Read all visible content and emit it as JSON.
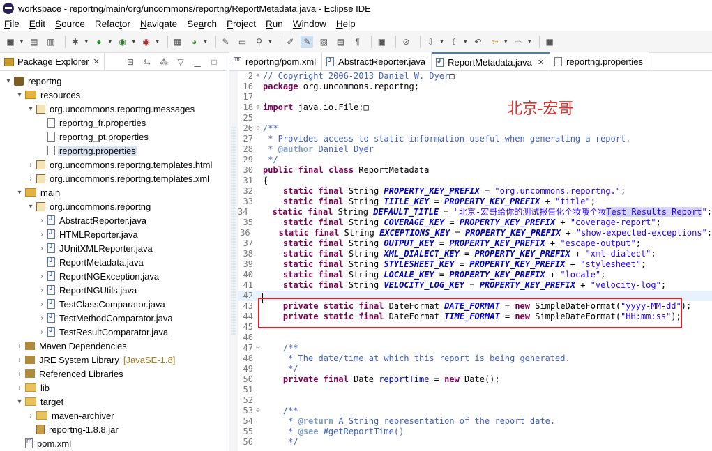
{
  "window": {
    "title": "workspace - reportng/main/org/uncommons/reportng/ReportMetadata.java - Eclipse IDE"
  },
  "menu": [
    {
      "u": "F",
      "rest": "ile"
    },
    {
      "u": "E",
      "rest": "dit"
    },
    {
      "u": "S",
      "rest": "ource"
    },
    {
      "pre": "Refac",
      "u": "t",
      "rest": "or"
    },
    {
      "u": "N",
      "rest": "avigate"
    },
    {
      "pre": "Se",
      "u": "a",
      "rest": "rch"
    },
    {
      "u": "P",
      "rest": "roject"
    },
    {
      "u": "R",
      "rest": "un"
    },
    {
      "u": "W",
      "rest": "indow"
    },
    {
      "u": "H",
      "rest": "elp"
    }
  ],
  "explorer": {
    "title": "Package Explorer",
    "tree": [
      {
        "level": 0,
        "twisty": "▾",
        "icon": "project",
        "label": "reportng"
      },
      {
        "level": 1,
        "twisty": "▾",
        "icon": "folder-src",
        "label": "resources"
      },
      {
        "level": 2,
        "twisty": "▾",
        "icon": "package",
        "label": "org.uncommons.reportng.messages"
      },
      {
        "level": 3,
        "twisty": "",
        "icon": "file-prop",
        "label": "reportng_fr.properties"
      },
      {
        "level": 3,
        "twisty": "",
        "icon": "file-prop",
        "label": "reportng_pt.properties"
      },
      {
        "level": 3,
        "twisty": "",
        "icon": "file-prop",
        "label": "reportng.properties",
        "selected": true
      },
      {
        "level": 2,
        "twisty": "›",
        "icon": "package",
        "label": "org.uncommons.reportng.templates.html"
      },
      {
        "level": 2,
        "twisty": "›",
        "icon": "package",
        "label": "org.uncommons.reportng.templates.xml"
      },
      {
        "level": 1,
        "twisty": "▾",
        "icon": "folder-src",
        "label": "main"
      },
      {
        "level": 2,
        "twisty": "▾",
        "icon": "package",
        "label": "org.uncommons.reportng"
      },
      {
        "level": 3,
        "twisty": "›",
        "icon": "file-java",
        "label": "AbstractReporter.java"
      },
      {
        "level": 3,
        "twisty": "›",
        "icon": "file-java",
        "label": "HTMLReporter.java"
      },
      {
        "level": 3,
        "twisty": "›",
        "icon": "file-java",
        "label": "JUnitXMLReporter.java"
      },
      {
        "level": 3,
        "twisty": "",
        "icon": "file-java",
        "label": "ReportMetadata.java"
      },
      {
        "level": 3,
        "twisty": "›",
        "icon": "file-java",
        "label": "ReportNGException.java"
      },
      {
        "level": 3,
        "twisty": "›",
        "icon": "file-java",
        "label": "ReportNGUtils.java"
      },
      {
        "level": 3,
        "twisty": "›",
        "icon": "file-java",
        "label": "TestClassComparator.java"
      },
      {
        "level": 3,
        "twisty": "›",
        "icon": "file-java",
        "label": "TestMethodComparator.java"
      },
      {
        "level": 3,
        "twisty": "›",
        "icon": "file-java",
        "label": "TestResultComparator.java"
      },
      {
        "level": 1,
        "twisty": "›",
        "icon": "lib",
        "label": "Maven Dependencies"
      },
      {
        "level": 1,
        "twisty": "›",
        "icon": "lib",
        "label": "JRE System Library",
        "extra": "[JavaSE-1.8]"
      },
      {
        "level": 1,
        "twisty": "›",
        "icon": "lib",
        "label": "Referenced Libraries"
      },
      {
        "level": 1,
        "twisty": "›",
        "icon": "folder",
        "label": "lib"
      },
      {
        "level": 1,
        "twisty": "▾",
        "icon": "folder",
        "label": "target"
      },
      {
        "level": 2,
        "twisty": "›",
        "icon": "folder",
        "label": "maven-archiver"
      },
      {
        "level": 2,
        "twisty": "",
        "icon": "jar",
        "label": "reportng-1.8.8.jar"
      },
      {
        "level": 1,
        "twisty": "",
        "icon": "pom",
        "label": "pom.xml"
      }
    ]
  },
  "editor": {
    "tabs": [
      {
        "label": "reportng/pom.xml",
        "icon": "pom",
        "active": false,
        "closable": false
      },
      {
        "label": "AbstractReporter.java",
        "icon": "java",
        "active": false,
        "closable": false
      },
      {
        "label": "ReportMetadata.java",
        "icon": "java",
        "active": true,
        "closable": true
      },
      {
        "label": "reportng.properties",
        "icon": "prop",
        "active": false,
        "closable": false
      }
    ],
    "watermark": "北京-宏哥",
    "lines": [
      {
        "n": "2",
        "fold": "⊕",
        "tokens": [
          [
            "cm",
            "// Copyright 2006-2013 Daniel W. Dyer"
          ],
          [
            "",
            "□"
          ]
        ]
      },
      {
        "n": "16",
        "tokens": [
          [
            "kw",
            "package"
          ],
          [
            "",
            " org.uncommons.reportng;"
          ]
        ]
      },
      {
        "n": "17",
        "tokens": []
      },
      {
        "n": "18",
        "fold": "⊕",
        "tokens": [
          [
            "kw",
            "import"
          ],
          [
            "",
            " java.io.File;□"
          ]
        ]
      },
      {
        "n": "25",
        "tokens": []
      },
      {
        "n": "26",
        "fold": "⊖",
        "tokens": [
          [
            "cm",
            "/**"
          ]
        ]
      },
      {
        "n": "27",
        "tokens": [
          [
            "cm",
            " * Provides access to static information useful when generating a report."
          ]
        ]
      },
      {
        "n": "28",
        "tokens": [
          [
            "cm",
            " * "
          ],
          [
            "cmtag",
            "@author"
          ],
          [
            "cm",
            " Daniel Dyer"
          ]
        ]
      },
      {
        "n": "29",
        "tokens": [
          [
            "cm",
            " */"
          ]
        ]
      },
      {
        "n": "30",
        "tokens": [
          [
            "kw",
            "public"
          ],
          [
            "",
            " "
          ],
          [
            "kw",
            "final"
          ],
          [
            "",
            " "
          ],
          [
            "kw",
            "class"
          ],
          [
            "",
            " ReportMetadata"
          ]
        ]
      },
      {
        "n": "31",
        "tokens": [
          [
            "",
            "{"
          ]
        ]
      },
      {
        "n": "32",
        "tokens": [
          [
            "",
            "    "
          ],
          [
            "kw",
            "static"
          ],
          [
            "",
            " "
          ],
          [
            "kw",
            "final"
          ],
          [
            "",
            " String "
          ],
          [
            "sfin",
            "PROPERTY_KEY_PREFIX"
          ],
          [
            "",
            " = "
          ],
          [
            "str",
            "\"org.uncommons.reportng.\""
          ],
          [
            "",
            ";"
          ]
        ]
      },
      {
        "n": "33",
        "tokens": [
          [
            "",
            "    "
          ],
          [
            "kw",
            "static"
          ],
          [
            "",
            " "
          ],
          [
            "kw",
            "final"
          ],
          [
            "",
            " String "
          ],
          [
            "sfin",
            "TITLE_KEY"
          ],
          [
            "",
            " = "
          ],
          [
            "sfin",
            "PROPERTY_KEY_PREFIX"
          ],
          [
            "",
            " + "
          ],
          [
            "str",
            "\"title\""
          ],
          [
            "",
            ";"
          ]
        ]
      },
      {
        "n": "34",
        "tokens": [
          [
            "",
            "    "
          ],
          [
            "kw",
            "static"
          ],
          [
            "",
            " "
          ],
          [
            "kw",
            "final"
          ],
          [
            "",
            " String "
          ],
          [
            "sfin",
            "DEFAULT_TITLE"
          ],
          [
            "",
            " = "
          ],
          [
            "str",
            "\"北京-宏哥给你的测试报告化个妆哦个妆"
          ],
          [
            "str hl",
            "Test Results Report"
          ],
          [
            "str",
            "\""
          ],
          [
            "",
            ";"
          ]
        ]
      },
      {
        "n": "35",
        "tokens": [
          [
            "",
            "    "
          ],
          [
            "kw",
            "static"
          ],
          [
            "",
            " "
          ],
          [
            "kw",
            "final"
          ],
          [
            "",
            " String "
          ],
          [
            "sfin",
            "COVERAGE_KEY"
          ],
          [
            "",
            " = "
          ],
          [
            "sfin",
            "PROPERTY_KEY_PREFIX"
          ],
          [
            "",
            " + "
          ],
          [
            "str",
            "\"coverage-report\""
          ],
          [
            "",
            ";"
          ]
        ]
      },
      {
        "n": "36",
        "tokens": [
          [
            "",
            "    "
          ],
          [
            "kw",
            "static"
          ],
          [
            "",
            " "
          ],
          [
            "kw",
            "final"
          ],
          [
            "",
            " String "
          ],
          [
            "sfin",
            "EXCEPTIONS_KEY"
          ],
          [
            "",
            " = "
          ],
          [
            "sfin",
            "PROPERTY_KEY_PREFIX"
          ],
          [
            "",
            " + "
          ],
          [
            "str",
            "\"show-expected-exceptions\""
          ],
          [
            "",
            ";"
          ]
        ]
      },
      {
        "n": "37",
        "tokens": [
          [
            "",
            "    "
          ],
          [
            "kw",
            "static"
          ],
          [
            "",
            " "
          ],
          [
            "kw",
            "final"
          ],
          [
            "",
            " String "
          ],
          [
            "sfin",
            "OUTPUT_KEY"
          ],
          [
            "",
            " = "
          ],
          [
            "sfin",
            "PROPERTY_KEY_PREFIX"
          ],
          [
            "",
            " + "
          ],
          [
            "str",
            "\"escape-output\""
          ],
          [
            "",
            ";"
          ]
        ]
      },
      {
        "n": "38",
        "tokens": [
          [
            "",
            "    "
          ],
          [
            "kw",
            "static"
          ],
          [
            "",
            " "
          ],
          [
            "kw",
            "final"
          ],
          [
            "",
            " String "
          ],
          [
            "sfin",
            "XML_DIALECT_KEY"
          ],
          [
            "",
            " = "
          ],
          [
            "sfin",
            "PROPERTY_KEY_PREFIX"
          ],
          [
            "",
            " + "
          ],
          [
            "str",
            "\"xml-dialect\""
          ],
          [
            "",
            ";"
          ]
        ]
      },
      {
        "n": "39",
        "tokens": [
          [
            "",
            "    "
          ],
          [
            "kw",
            "static"
          ],
          [
            "",
            " "
          ],
          [
            "kw",
            "final"
          ],
          [
            "",
            " String "
          ],
          [
            "sfin",
            "STYLESHEET_KEY"
          ],
          [
            "",
            " = "
          ],
          [
            "sfin",
            "PROPERTY_KEY_PREFIX"
          ],
          [
            "",
            " + "
          ],
          [
            "str",
            "\"stylesheet\""
          ],
          [
            "",
            ";"
          ]
        ]
      },
      {
        "n": "40",
        "tokens": [
          [
            "",
            "    "
          ],
          [
            "kw",
            "static"
          ],
          [
            "",
            " "
          ],
          [
            "kw",
            "final"
          ],
          [
            "",
            " String "
          ],
          [
            "sfin",
            "LOCALE_KEY"
          ],
          [
            "",
            " = "
          ],
          [
            "sfin",
            "PROPERTY_KEY_PREFIX"
          ],
          [
            "",
            " + "
          ],
          [
            "str",
            "\"locale\""
          ],
          [
            "",
            ";"
          ]
        ]
      },
      {
        "n": "41",
        "tokens": [
          [
            "",
            "    "
          ],
          [
            "kw",
            "static"
          ],
          [
            "",
            " "
          ],
          [
            "kw",
            "final"
          ],
          [
            "",
            " String "
          ],
          [
            "sfin",
            "VELOCITY_LOG_KEY"
          ],
          [
            "",
            " = "
          ],
          [
            "sfin",
            "PROPERTY_KEY_PREFIX"
          ],
          [
            "",
            " + "
          ],
          [
            "str",
            "\"velocity-log\""
          ],
          [
            "",
            ";"
          ]
        ]
      },
      {
        "n": "42",
        "current": true,
        "tokens": []
      },
      {
        "n": "43",
        "tokens": [
          [
            "",
            "    "
          ],
          [
            "kw",
            "private"
          ],
          [
            "",
            " "
          ],
          [
            "kw",
            "static"
          ],
          [
            "",
            " "
          ],
          [
            "kw",
            "final"
          ],
          [
            "",
            " DateFormat "
          ],
          [
            "sfin",
            "DATE_FORMAT"
          ],
          [
            "",
            " = "
          ],
          [
            "kw",
            "new"
          ],
          [
            "",
            " SimpleDateFormat("
          ],
          [
            "str",
            "\"yyyy-MM-dd\""
          ],
          [
            "",
            ");"
          ]
        ]
      },
      {
        "n": "44",
        "tokens": [
          [
            "",
            "    "
          ],
          [
            "kw",
            "private"
          ],
          [
            "",
            " "
          ],
          [
            "kw",
            "static"
          ],
          [
            "",
            " "
          ],
          [
            "kw",
            "final"
          ],
          [
            "",
            " DateFormat "
          ],
          [
            "sfin",
            "TIME_FORMAT"
          ],
          [
            "",
            " = "
          ],
          [
            "kw",
            "new"
          ],
          [
            "",
            " SimpleDateFormat("
          ],
          [
            "str",
            "\"HH:mm:ss\""
          ],
          [
            "",
            ");"
          ]
        ]
      },
      {
        "n": "45",
        "tokens": []
      },
      {
        "n": "46",
        "tokens": []
      },
      {
        "n": "47",
        "fold": "⊖",
        "tokens": [
          [
            "",
            "    "
          ],
          [
            "cm",
            "/**"
          ]
        ]
      },
      {
        "n": "48",
        "tokens": [
          [
            "cm",
            "     * The date/time at which this report is being generated."
          ]
        ]
      },
      {
        "n": "49",
        "tokens": [
          [
            "cm",
            "     */"
          ]
        ]
      },
      {
        "n": "50",
        "tokens": [
          [
            "",
            "    "
          ],
          [
            "kw",
            "private"
          ],
          [
            "",
            " "
          ],
          [
            "kw",
            "final"
          ],
          [
            "",
            " Date "
          ],
          [
            "fld",
            "reportTime"
          ],
          [
            "",
            " = "
          ],
          [
            "kw",
            "new"
          ],
          [
            "",
            " Date();"
          ]
        ]
      },
      {
        "n": "51",
        "tokens": []
      },
      {
        "n": "52",
        "tokens": []
      },
      {
        "n": "53",
        "fold": "⊖",
        "tokens": [
          [
            "",
            "    "
          ],
          [
            "cm",
            "/**"
          ]
        ]
      },
      {
        "n": "54",
        "tokens": [
          [
            "cm",
            "     * "
          ],
          [
            "cmtag",
            "@return"
          ],
          [
            "cm",
            " A String representation of the report date."
          ]
        ]
      },
      {
        "n": "55",
        "tokens": [
          [
            "cm",
            "     * "
          ],
          [
            "cmtag",
            "@see"
          ],
          [
            "cm",
            " #getReportTime()"
          ]
        ]
      },
      {
        "n": "56",
        "tokens": [
          [
            "cm",
            "     */"
          ]
        ]
      }
    ]
  }
}
